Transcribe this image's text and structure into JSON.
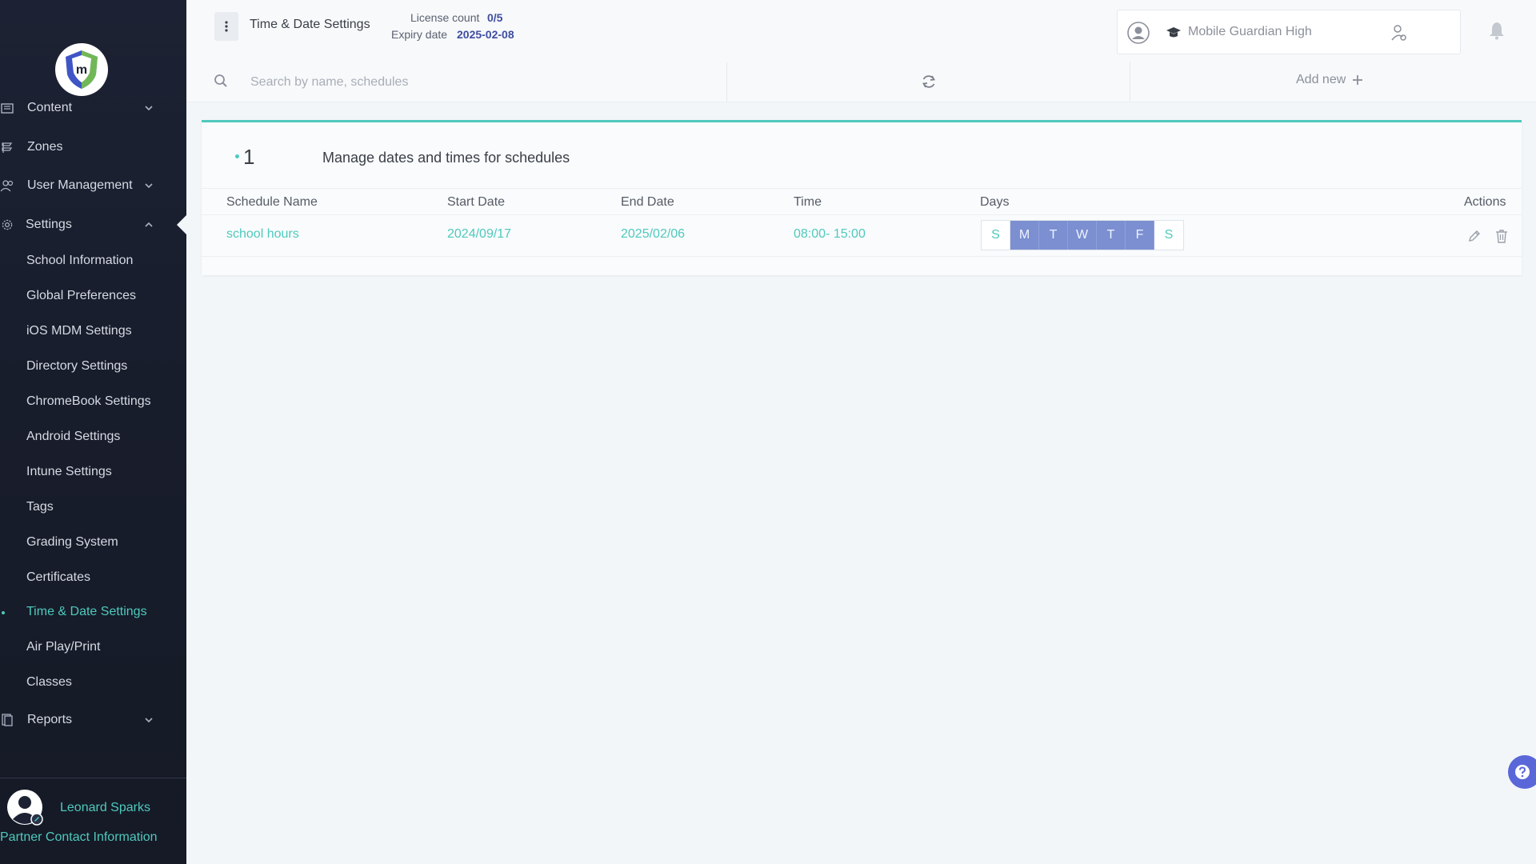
{
  "sidebar": {
    "logo_text": "m",
    "items": [
      {
        "label": "Content"
      },
      {
        "label": "Zones"
      },
      {
        "label": "User Management"
      },
      {
        "label": "Settings"
      },
      {
        "label": "Reports"
      }
    ],
    "settings_sub": [
      {
        "label": "School Information"
      },
      {
        "label": "Global Preferences"
      },
      {
        "label": "iOS MDM Settings"
      },
      {
        "label": "Directory Settings"
      },
      {
        "label": "ChromeBook Settings"
      },
      {
        "label": "Android Settings"
      },
      {
        "label": "Intune Settings"
      },
      {
        "label": "Tags"
      },
      {
        "label": "Grading System"
      },
      {
        "label": "Certificates"
      },
      {
        "label": "Time & Date Settings"
      },
      {
        "label": "Air Play/Print"
      },
      {
        "label": "Classes"
      }
    ],
    "active_item": "Time & Date Settings",
    "user_name": "Leonard Sparks",
    "partner_link": "Partner Contact Information"
  },
  "header": {
    "title": "Time & Date Settings",
    "license_label": "License count",
    "license_value": "0/5",
    "expiry_label": "Expiry date",
    "expiry_value": "2025-02-08",
    "school_name": "Mobile Guardian High"
  },
  "toolbar": {
    "search_placeholder": "Search by name, schedules",
    "add_new_label": "Add new"
  },
  "card": {
    "count": "1",
    "subtitle": "Manage dates and times for schedules",
    "columns": [
      "Schedule Name",
      "Start Date",
      "End Date",
      "Time",
      "Days",
      "Actions"
    ],
    "rows": [
      {
        "name": "school hours",
        "start": "2024/09/17",
        "end": "2025/02/06",
        "time": "08:00- 15:00",
        "days": [
          {
            "label": "S",
            "on": false
          },
          {
            "label": "M",
            "on": true
          },
          {
            "label": "T",
            "on": true
          },
          {
            "label": "W",
            "on": true
          },
          {
            "label": "T",
            "on": true
          },
          {
            "label": "F",
            "on": true
          },
          {
            "label": "S",
            "on": false
          }
        ]
      }
    ]
  },
  "colors": {
    "accent": "#4fc9bd",
    "sidebar_bg": "#1a2030",
    "day_selected": "#7b8fd1",
    "help_button": "#5a67d8"
  }
}
